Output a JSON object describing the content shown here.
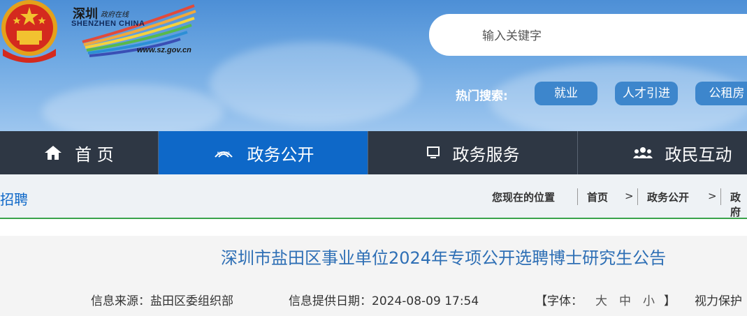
{
  "header": {
    "logo_cn": "深圳",
    "logo_sub": "政府在线",
    "logo_en": "SHENZHEN CHINA",
    "logo_url": "www.sz.gov.cn",
    "search_placeholder": "输入关键字",
    "hot_label": "热门搜索:",
    "hot_tags": [
      "就业",
      "人才引进",
      "公租房"
    ]
  },
  "nav": {
    "items": [
      {
        "label": "首 页",
        "icon": "home-icon"
      },
      {
        "label": "政务公开",
        "icon": "news-icon"
      },
      {
        "label": "政务服务",
        "icon": "monitor-icon"
      },
      {
        "label": "政民互动",
        "icon": "people-icon"
      }
    ]
  },
  "crumbbar": {
    "section": "招聘",
    "location_label": "您现在的位置",
    "crumbs": [
      "首页",
      "政务公开",
      "政府"
    ],
    "arrow": ">"
  },
  "article": {
    "title": "深圳市盐田区事业单位2024年专项公开选聘博士研究生公告",
    "source": "信息来源：盐田区委组织部",
    "date": "信息提供日期：2024-08-09 17:54",
    "font_open": "【字体：",
    "font_large": "大",
    "font_medium": "中",
    "font_small": "小",
    "font_close": "】",
    "eye_protect": "视力保护"
  },
  "colors": {
    "nav_bg": "#2e3744",
    "nav_active": "#0e68c8",
    "title": "#2e6fb5",
    "accent_line": "#3aa34a"
  }
}
